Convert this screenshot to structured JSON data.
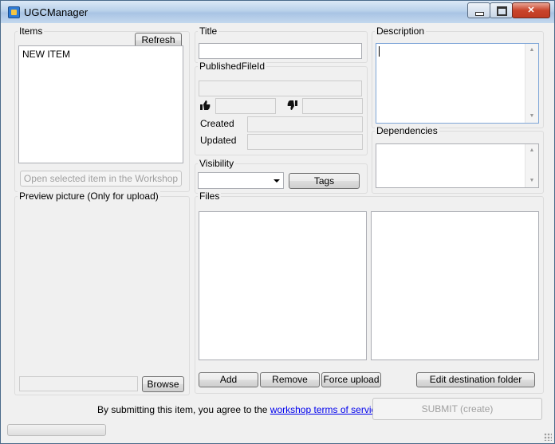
{
  "window": {
    "title": "UGCManager"
  },
  "items": {
    "label": "Items",
    "refresh_label": "Refresh",
    "list": [
      "NEW ITEM"
    ],
    "open_workshop_label": "Open selected item in the Workshop"
  },
  "title_field": {
    "label": "Title",
    "value": ""
  },
  "published": {
    "label": "PublishedFileId",
    "value": "",
    "upvotes": "",
    "downvotes": "",
    "created_label": "Created",
    "created_value": "",
    "updated_label": "Updated",
    "updated_value": ""
  },
  "visibility": {
    "label": "Visibility",
    "selected": "",
    "tags_label": "Tags"
  },
  "description": {
    "label": "Description",
    "value": ""
  },
  "dependencies": {
    "label": "Dependencies",
    "value": ""
  },
  "preview": {
    "label": "Preview picture (Only for upload)",
    "path": "",
    "browse_label": "Browse"
  },
  "files": {
    "label": "Files",
    "add_label": "Add",
    "remove_label": "Remove",
    "force_upload_label": "Force upload",
    "edit_dest_label": "Edit destination folder"
  },
  "footer": {
    "agree_text": "By submitting this item, you agree to the",
    "tos_link": "workshop terms of service",
    "period": ".",
    "submit_label": "SUBMIT (create)"
  },
  "colors": {
    "link": "#0000ee",
    "disabled_text": "#a0a0a0",
    "title_bar": "#b9d1ea",
    "close_button": "#c9442b"
  },
  "icons": [
    "app-icon",
    "minimize-icon",
    "maximize-icon",
    "close-icon",
    "thumbs-up-icon",
    "thumbs-down-icon",
    "dropdown-arrow-icon",
    "size-grip-icon"
  ]
}
